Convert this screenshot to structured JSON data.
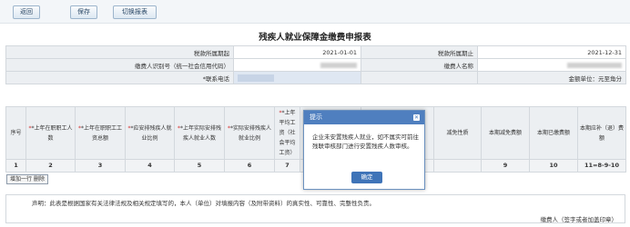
{
  "toolbar": {
    "back": "返回",
    "save": "保存",
    "switch": "切换报表"
  },
  "title": "残疾人就业保障金缴费申报表",
  "meta": {
    "period_start_label": "税款所属期起",
    "period_start_value": "2021-01-01",
    "period_end_label": "税款所属期止",
    "period_end_value": "2021-12-31",
    "payer_id_label": "缴费人识别号（统一社会信用代码）",
    "payer_name_label": "缴费人名称",
    "phone_label": "*联系电话",
    "unit_label": "金额单位：元至角分"
  },
  "columns": [
    "序号",
    "*上年在职职工人数",
    "*上年在职职工工资总额",
    "*应安排残疾人就业比例",
    "*上年实际安排残疾人就业人数",
    "*实际安排残疾人就业比例",
    "*上年平均工资（社会平均工资）",
    "",
    "",
    "减免性质",
    "本期减免费额",
    "本期已缴费额",
    "本期应补（退）费额"
  ],
  "column_numbers": [
    "1",
    "2",
    "3",
    "4",
    "5",
    "6",
    "7",
    "",
    "",
    "",
    "9",
    "10",
    "11=8-9-10"
  ],
  "add_row": "增加一行",
  "delete": "删除",
  "declaration": "声明：此表是根据国家有关法律法规及相关规定填写的，本人（单位）对填报内容（及附带资料）的真实性、可靠性、完整性负责。",
  "signature": "缴费人（签字或者加盖印章）",
  "dialog": {
    "title": "提示",
    "message": "企业未安置残疾人就业，如不属实可前往残联审核部门进行安置残疾人数审核。",
    "ok": "确定"
  }
}
